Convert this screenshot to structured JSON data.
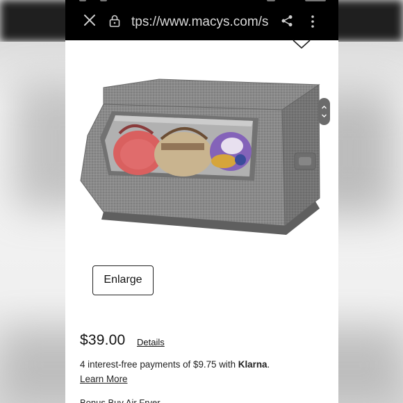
{
  "browser": {
    "url_text": "tps://www.macys.com/s",
    "icons": [
      "close-icon",
      "lock-icon",
      "share-icon",
      "more-vertical-icon"
    ]
  },
  "product": {
    "image_alt": "Gray fabric storage bin with clear front window",
    "enlarge_label": "Enlarge",
    "price": "$39.00",
    "details_label": "Details",
    "installments_text": "4 interest-free payments of $9.75 with",
    "klarna_label": "Klarna",
    "installments_suffix": ".",
    "learn_more_label": "Learn More",
    "promo_partial": "Bonus Buy Air Fryer"
  },
  "colors": {
    "topbar": "#000000",
    "page_bg": "#ffffff",
    "text": "#111111"
  }
}
